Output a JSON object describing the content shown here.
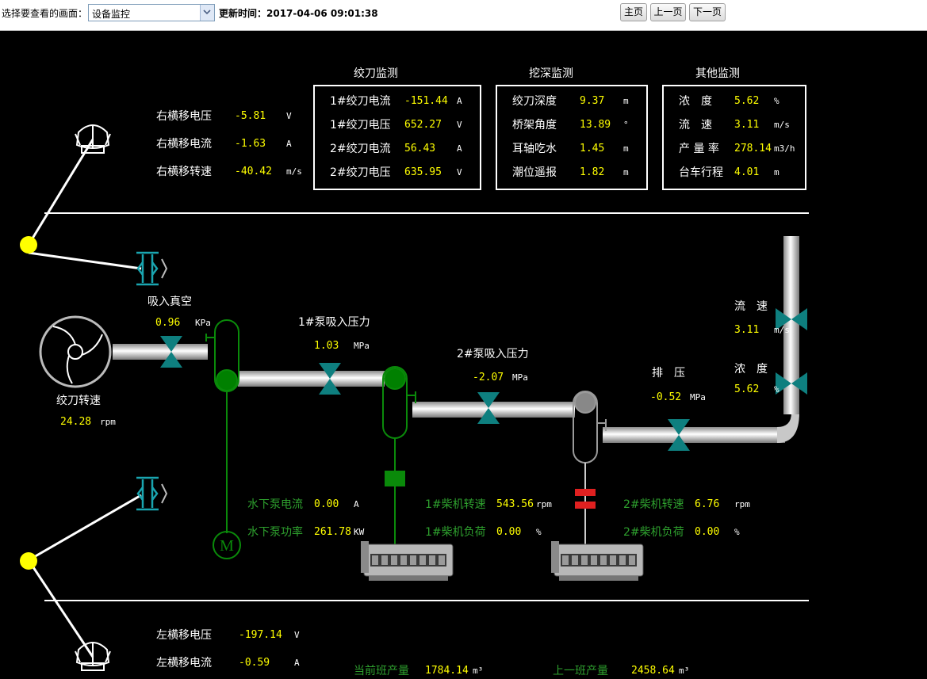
{
  "toolbar": {
    "select_label": "选择要查看的画面：",
    "select_value": "设备监控",
    "update_label": "更新时间：2017-04-06 09:01:38",
    "home_label": "主页",
    "prev_label": "上一页",
    "next_label": "下一页"
  },
  "colors": {
    "pipe": "#e6e6e6",
    "valve": "#0e7f7f",
    "pump_green": "#008000",
    "value": "#ffff00",
    "label_green": "#2ea02e",
    "indicator_yellow": "#ffff00",
    "coupling_red": "#e02020"
  },
  "traverse_right": {
    "voltage": {
      "label": "右横移电压",
      "value": "-5.81",
      "unit": "V"
    },
    "current": {
      "label": "右横移电流",
      "value": "-1.63",
      "unit": "A"
    },
    "speed": {
      "label": "右横移转速",
      "value": "-40.42",
      "unit": "m/s"
    }
  },
  "traverse_left": {
    "voltage": {
      "label": "左横移电压",
      "value": "-197.14",
      "unit": "V"
    },
    "current": {
      "label": "左横移电流",
      "value": "-0.59",
      "unit": "A"
    }
  },
  "cutter_panel": {
    "title": "绞刀监测",
    "rows": [
      {
        "label": "1#绞刀电流",
        "value": "-151.44",
        "unit": "A"
      },
      {
        "label": "1#绞刀电压",
        "value": "652.27",
        "unit": "V"
      },
      {
        "label": "2#绞刀电流",
        "value": "56.43",
        "unit": "A"
      },
      {
        "label": "2#绞刀电压",
        "value": "635.95",
        "unit": "V"
      }
    ]
  },
  "dredge_panel": {
    "title": "挖深监测",
    "rows": [
      {
        "label": "绞刀深度",
        "value": "9.37",
        "unit": "m"
      },
      {
        "label": "桥架角度",
        "value": "13.89",
        "unit": "°"
      },
      {
        "label": "耳轴吃水",
        "value": "1.45",
        "unit": "m"
      },
      {
        "label": "潮位遥报",
        "value": "1.82",
        "unit": "m"
      }
    ]
  },
  "other_panel": {
    "title": "其他监测",
    "rows": [
      {
        "label": "浓　度",
        "value": "5.62",
        "unit": "%"
      },
      {
        "label": "流　速",
        "value": "3.11",
        "unit": "m/s"
      },
      {
        "label": "产 量 率",
        "value": "278.14",
        "unit": "m3/h"
      },
      {
        "label": "台车行程",
        "value": "4.01",
        "unit": "m"
      }
    ]
  },
  "suction_vacuum": {
    "label": "吸入真空",
    "value": "0.96",
    "unit": "KPa"
  },
  "cutter_speed": {
    "label": "绞刀转速",
    "value": "24.28",
    "unit": "rpm"
  },
  "pump1_suction": {
    "label": "1#泵吸入压力",
    "value": "1.03",
    "unit": "MPa"
  },
  "pump2_suction": {
    "label": "2#泵吸入压力",
    "value": "-2.07",
    "unit": "MPa"
  },
  "discharge": {
    "label": "排　压",
    "value": "-0.52",
    "unit": "MPa"
  },
  "flow_speed": {
    "label": "流　速",
    "value": "3.11",
    "unit": "m/s"
  },
  "concentration": {
    "label": "浓　度",
    "value": "5.62",
    "unit": "%"
  },
  "underwater_pump": {
    "current": {
      "label": "水下泵电流",
      "value": "0.00",
      "unit": "A"
    },
    "power": {
      "label": "水下泵功率",
      "value": "261.78",
      "unit": "KW"
    },
    "motor_symbol": "M"
  },
  "diesel1": {
    "speed": {
      "label": "1#柴机转速",
      "value": "543.56",
      "unit": "rpm"
    },
    "load": {
      "label": "1#柴机负荷",
      "value": "0.00",
      "unit": "%"
    }
  },
  "diesel2": {
    "speed": {
      "label": "2#柴机转速",
      "value": "6.76",
      "unit": "rpm"
    },
    "load": {
      "label": "2#柴机负荷",
      "value": "0.00",
      "unit": "%"
    }
  },
  "production": {
    "current_shift": {
      "label": "当前班产量",
      "value": "1784.14",
      "unit": "m³"
    },
    "last_shift": {
      "label": "上一班产量",
      "value": "2458.64",
      "unit": "m³"
    }
  }
}
